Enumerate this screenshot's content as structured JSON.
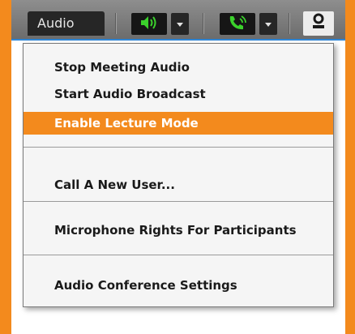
{
  "toolbar": {
    "pod_title": "Audio",
    "speaker_icon": "speaker-icon",
    "phone_icon": "phone-icon",
    "person_icon": "person-icon",
    "accent_color": "#2e86d6",
    "icon_green": "#3bd12c"
  },
  "menu": {
    "items": [
      {
        "label": "Stop Meeting Audio"
      },
      {
        "label": "Start Audio Broadcast"
      },
      {
        "label": "Enable Lecture Mode"
      },
      {
        "label": "Call A New User..."
      },
      {
        "label": "Microphone Rights For Participants"
      },
      {
        "label": "Audio Conference Settings"
      }
    ],
    "highlight_color": "#f38a1d"
  }
}
